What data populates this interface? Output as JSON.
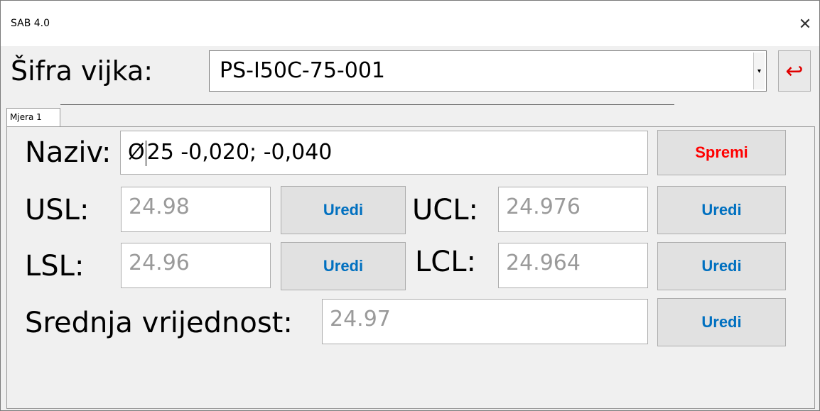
{
  "window": {
    "title": "SAB 4.0",
    "close_glyph": "✕"
  },
  "header": {
    "code_label": "Šifra vijka:",
    "code_value": "PS-I50C-75-001",
    "dropdown_glyph": "▾",
    "return_glyph": "↩"
  },
  "tabs": [
    {
      "label": "Mjera 1",
      "selected": true
    }
  ],
  "form": {
    "naziv_label": "Naziv:",
    "naziv_symbol": "Ø",
    "naziv_rest": "25 -0,020; -0,040",
    "save_label": "Spremi",
    "usl_label": "USL:",
    "usl_value": "24.98",
    "ucl_label": "UCL:",
    "ucl_value": "24.976",
    "lsl_label": "LSL:",
    "lsl_value": "24.96",
    "lcl_label": "LCL:",
    "lcl_value": "24.964",
    "mean_label": "Srednja vrijednost:",
    "mean_value": "24.97",
    "edit_label": "Uredi"
  },
  "colors": {
    "edit_button_text": "#0070c0",
    "save_button_text": "#ff0000",
    "return_icon": "#e00000",
    "readonly_value_text": "#9a9a9a"
  },
  "icons": {
    "close": "close-icon",
    "dropdown": "chevron-down-icon",
    "return": "return-arrow-icon"
  }
}
